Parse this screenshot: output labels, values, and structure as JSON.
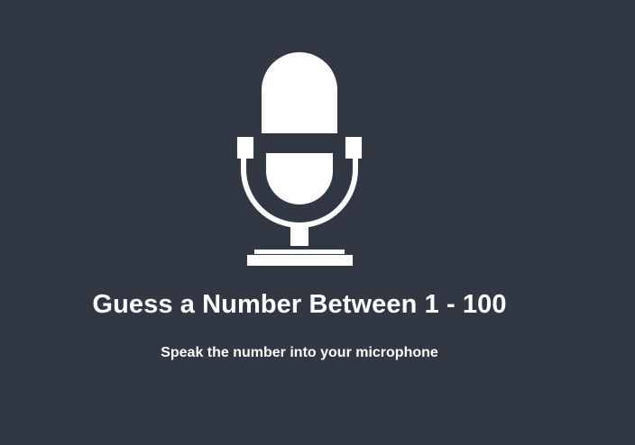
{
  "icon": {
    "name": "microphone-icon",
    "color": "#ffffff"
  },
  "background_color": "#323744",
  "heading": "Guess a Number Between 1 - 100",
  "instructions": "Speak the number into your microphone"
}
